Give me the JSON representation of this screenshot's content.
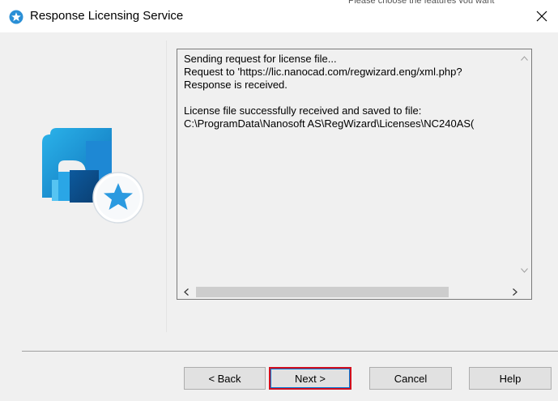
{
  "window": {
    "title": "Response Licensing Service",
    "close_glyph": "✕",
    "title_icon": "star-badge-icon"
  },
  "background": {
    "partial_text": "Please choose the features you want"
  },
  "logo": {
    "icon": "nanocad-star-logo-icon"
  },
  "log": {
    "lines": [
      "Sending request for license file...",
      "Request to 'https://lic.nanocad.com/regwizard.eng/xml.php?",
      "Response is received.",
      "",
      "License file successfully received and saved to file:",
      "C:\\ProgramData\\Nanosoft AS\\RegWizard\\Licenses\\NC240AS("
    ]
  },
  "buttons": {
    "back": "< Back",
    "next": "Next >",
    "cancel": "Cancel",
    "help": "Help"
  },
  "colors": {
    "accent_focus": "#0078d7",
    "highlight_box": "#d20f1e",
    "logo_blue": "#1a9be0",
    "logo_dark": "#0b4d8a"
  }
}
